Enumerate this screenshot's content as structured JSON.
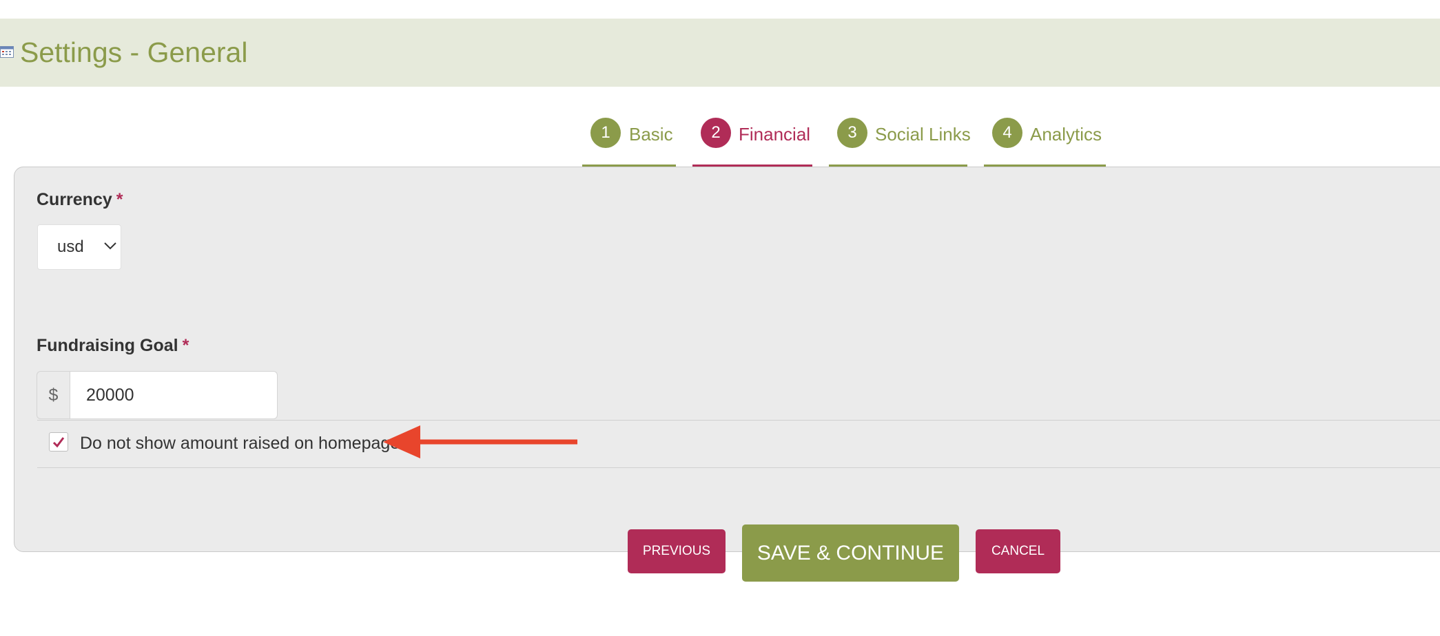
{
  "header": {
    "title": "Settings - General",
    "icon": "calendar-icon"
  },
  "tabs": [
    {
      "number": "1",
      "label": "Basic",
      "active": false
    },
    {
      "number": "2",
      "label": "Financial",
      "active": true
    },
    {
      "number": "3",
      "label": "Social Links",
      "active": false
    },
    {
      "number": "4",
      "label": "Analytics",
      "active": false
    }
  ],
  "form": {
    "currency": {
      "label": "Currency",
      "required_marker": "*",
      "value": "usd"
    },
    "fundraising_goal": {
      "label": "Fundraising Goal",
      "required_marker": "*",
      "prefix": "$",
      "value": "20000"
    },
    "hide_amount": {
      "label": "Do not show amount raised on homepage",
      "checked": true
    }
  },
  "buttons": {
    "previous": "PREVIOUS",
    "save": "SAVE & CONTINUE",
    "cancel": "CANCEL"
  },
  "colors": {
    "primary_green": "#8b9b4a",
    "accent_red": "#b02c57",
    "header_bg": "#e6eadb",
    "panel_bg": "#ebebeb",
    "annotation_arrow": "#e8452c"
  }
}
